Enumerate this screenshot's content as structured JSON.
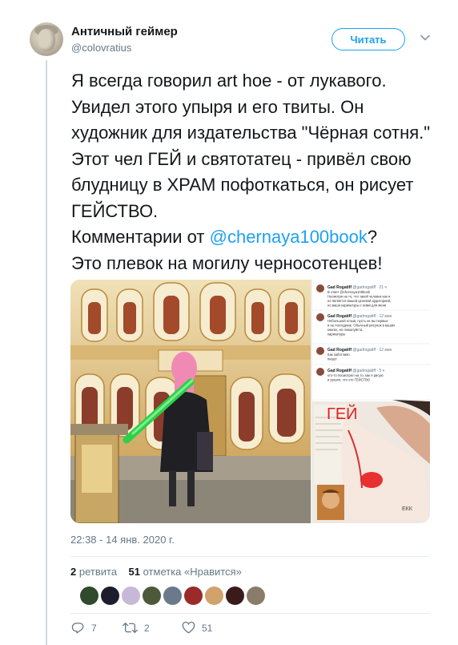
{
  "author": {
    "name": "Античный геймер",
    "handle": "@colovratius"
  },
  "follow_label": "Читать",
  "tweet": {
    "text_before": "Я всегда говорил art hoe - от лукавого.\nУвидел этого упыря и его твиты. Он художник для издательства \"Чёрная сотня.\"\nЭтот чел ГЕЙ и святотатец - привёл свою блудницу в ХРАМ пофоткаться, он рисует ГЕЙСТВО.\nКомментарии от ",
    "mention": "@chernaya100book",
    "text_after": "?\nЭто плевок на могилу черносотенцев!"
  },
  "media": {
    "screenshot_tweets": [
      {
        "name": "Gad Rogatiff",
        "handle": "@gadrogatiff · 21 ч",
        "lines": [
          "В ответ @chernaya100book",
          "Несмотря на то, что такой человек как я",
          "не является вашей целевой аудиторией,",
          "но ваши карикатуры с ними для меня"
        ]
      },
      {
        "name": "Gad Rogatiff",
        "handle": "@gadrogatiff · 12 мин",
        "lines": [
          "Небольшой отзыв, пусть не вы первые",
          "и не последние. Обычный рисунок в ваших",
          "книгах, но пожалуйста,",
          "карикатуры"
        ]
      },
      {
        "name": "Gad Rogatiff",
        "handle": "@gadrogatiff · 12 мин",
        "lines": [
          "Как заботливо",
          "пишут"
        ]
      },
      {
        "name": "Gad Rogatiff",
        "handle": "@gadrogatiff · 5 ч",
        "lines": [
          "кто-то посмотрел на то, как я рисую",
          "и решил, что это ГЕЙСТВО"
        ]
      }
    ],
    "drawing_label": "ГЕЙ",
    "drawing_corner": "ЕКК"
  },
  "timestamp": "22:38 - 14 янв. 2020 г.",
  "stats": {
    "retweets": "2",
    "retweets_label": "ретвита",
    "likes": "51",
    "likes_label": "отметка «Нравится»"
  },
  "likers": [
    "#2f4a2c",
    "#1d1d2e",
    "#c7b8d8",
    "#4d5a3a",
    "#6b7a8a",
    "#9b2a2a",
    "#d1a26b",
    "#3a1a1a",
    "#8a7c6a"
  ],
  "actions": {
    "replies": "7",
    "retweets": "2",
    "likes": "51"
  },
  "colors": {
    "accent": "#1da1f2",
    "secondary": "#657786"
  }
}
